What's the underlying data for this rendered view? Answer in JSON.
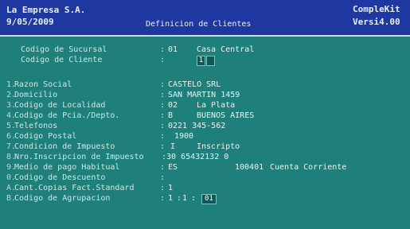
{
  "header": {
    "company": "La Empresa S.A.",
    "date": "9/05/2009",
    "title": "Definicion de Clientes",
    "product": "CompleKit",
    "version": "Versi4.00"
  },
  "sucursal": {
    "label": "Codigo de Sucursal",
    "code": "01",
    "name": "Casa Central"
  },
  "cliente": {
    "label": "Codigo de Cliente",
    "value": "1"
  },
  "fields": [
    {
      "num": "1.",
      "label": "Razon Social",
      "value": "CASTELO SRL"
    },
    {
      "num": "2.",
      "label": "Domicilio",
      "value": "SAN MARTIN 1459"
    },
    {
      "num": "3.",
      "label": "Codigo de Localidad",
      "code": "02",
      "value": "La Plata"
    },
    {
      "num": "4.",
      "label": "Codigo de Pcia./Depto.",
      "code": "B",
      "value": "BUENOS AIRES"
    },
    {
      "num": "5.",
      "label": "Telefonos",
      "value": "0221 345-562"
    },
    {
      "num": "6.",
      "label": "Codigo Postal",
      "value": "1900"
    },
    {
      "num": "7.",
      "label": "Condicion de Impuesto",
      "code": "I",
      "value": "Inscripto"
    },
    {
      "num": "8.",
      "label": "Nro.Inscripcion de Impuesto",
      "value": "30 65432132 0"
    },
    {
      "num": "9.",
      "label": "Medio de pago Habitual",
      "code": "ES",
      "extra": "100401",
      "value": "Cuenta Corriente"
    },
    {
      "num": "0.",
      "label": "Codigo de Descuento",
      "value": ""
    },
    {
      "num": "A.",
      "label": "Cant.Copias Fact.Standard",
      "value": "1"
    },
    {
      "num": "B.",
      "label": "Codigo de Agrupacion",
      "value": "1",
      "value2": "1",
      "value3": "01"
    }
  ]
}
